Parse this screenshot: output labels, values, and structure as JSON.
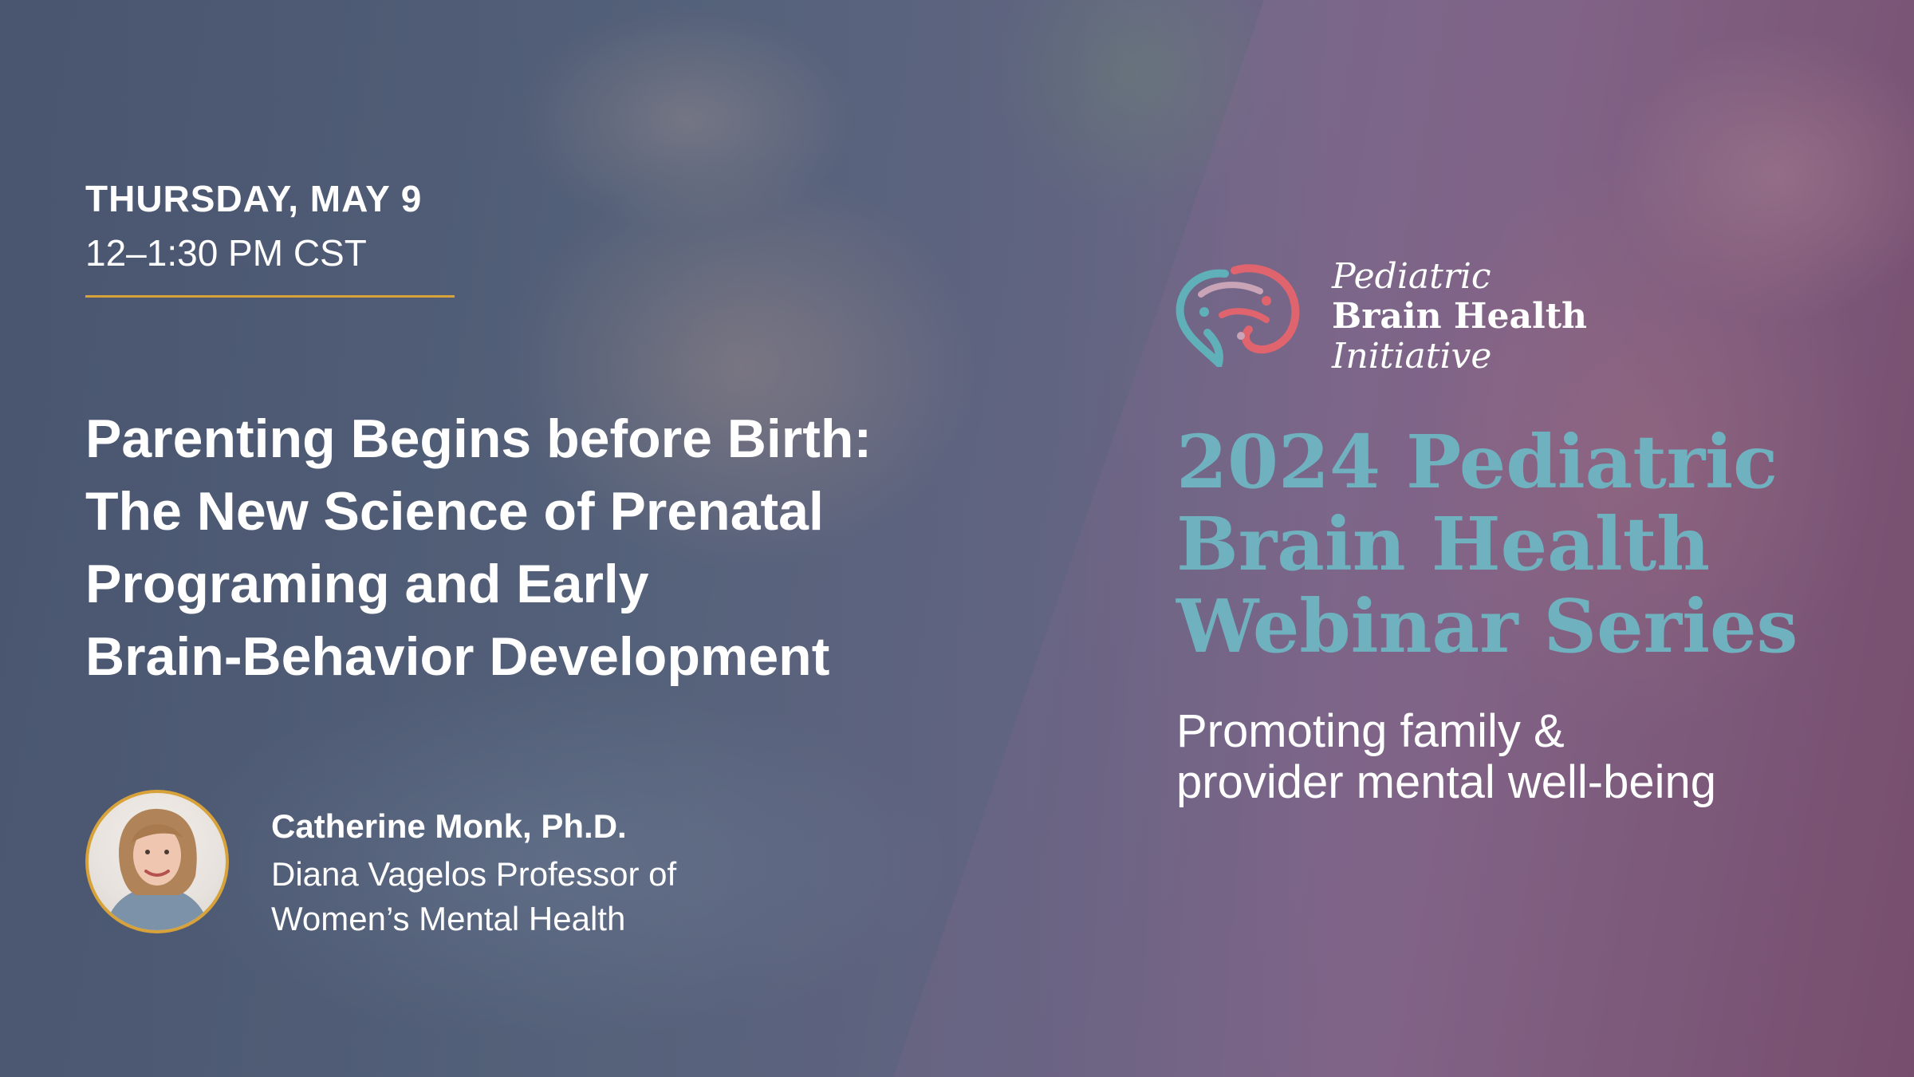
{
  "event": {
    "date": "THURSDAY, MAY 9",
    "time": "12–1:30 PM CST",
    "title_lines": [
      "Parenting Begins before Birth:",
      "The New Science of Prenatal",
      "Programing and Early",
      "Brain-Behavior Development"
    ]
  },
  "speaker": {
    "name": "Catherine Monk, Ph.D.",
    "role_lines": [
      "Diana Vagelos Professor of",
      "Women’s Mental Health"
    ]
  },
  "organization": {
    "name_lines": [
      "Pediatric",
      "Brain Health",
      "Initiative"
    ]
  },
  "series": {
    "title_lines": [
      "2024 Pediatric",
      "Brain Health",
      "Webinar Series"
    ],
    "tagline_lines": [
      "Promoting family &",
      "provider mental well-being"
    ]
  },
  "colors": {
    "accent_gold": "#d8a23a",
    "series_teal": "#6fb1bf",
    "logo_coral": "#e0646e",
    "logo_teal": "#5fb0b8"
  },
  "icons": {
    "logo": "brain-logo-icon",
    "avatar": "speaker-portrait"
  }
}
